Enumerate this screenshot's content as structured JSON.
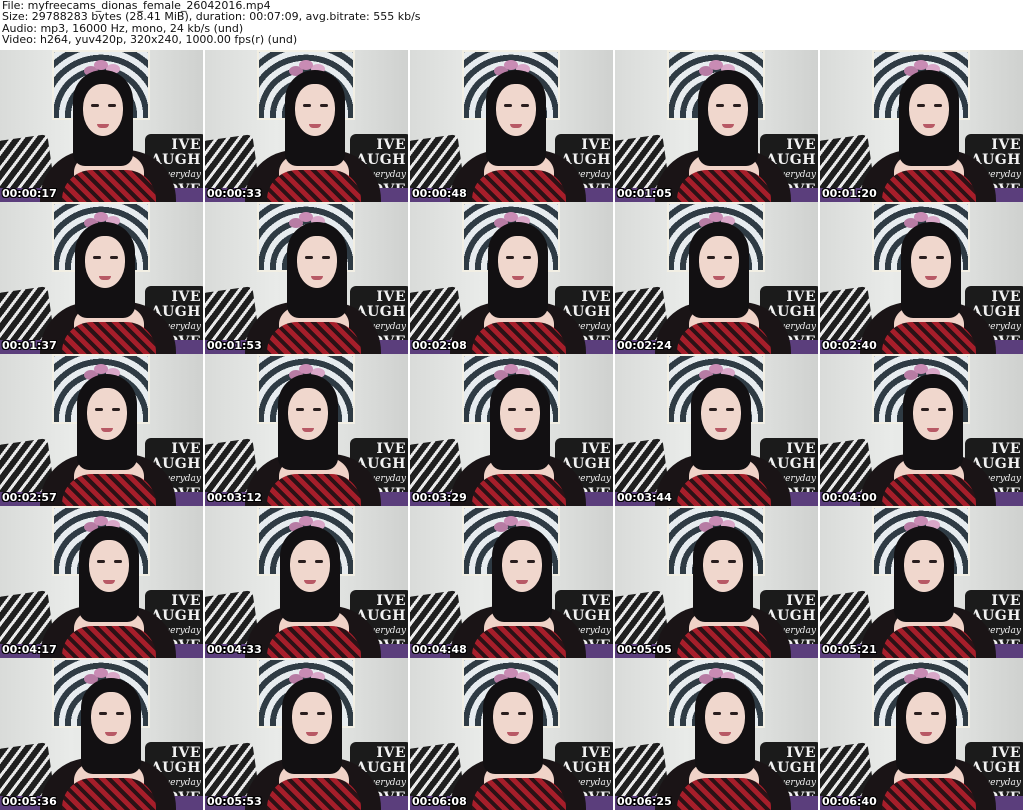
{
  "header": {
    "file": "File: myfreecams_dionas_female_26042016.mp4",
    "size": "Size: 29788283 bytes (28.41 MiB), duration: 00:07:09, avg.bitrate: 555 kb/s",
    "audio": "Audio: mp3, 16000 Hz, mono, 24 kb/s (und)",
    "video": "Video: h264, yuv420p, 320x240, 1000.00 fps(r) (und)"
  },
  "thumbs": [
    "00:00:17",
    "00:00:33",
    "00:00:48",
    "00:01:05",
    "00:01:20",
    "00:01:37",
    "00:01:53",
    "00:02:08",
    "00:02:24",
    "00:02:40",
    "00:02:57",
    "00:03:12",
    "00:03:29",
    "00:03:44",
    "00:04:00",
    "00:04:17",
    "00:04:33",
    "00:04:48",
    "00:05:05",
    "00:05:21",
    "00:05:36",
    "00:05:53",
    "00:06:08",
    "00:06:25",
    "00:06:40"
  ],
  "pillow_words": [
    "IVE",
    "AUGH",
    "everyday",
    "OVE"
  ]
}
